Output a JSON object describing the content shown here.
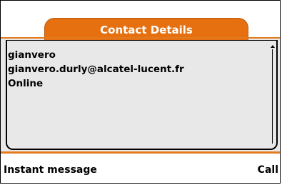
{
  "header": {
    "title": "Contact Details"
  },
  "contact": {
    "name": "gianvero",
    "email": "gianvero.durly@alcatel-lucent.fr",
    "status": "Online"
  },
  "softkeys": {
    "left": "Instant message",
    "right": "Call"
  },
  "colors": {
    "accent": "#e6700f",
    "panel": "#e8e8e8"
  }
}
